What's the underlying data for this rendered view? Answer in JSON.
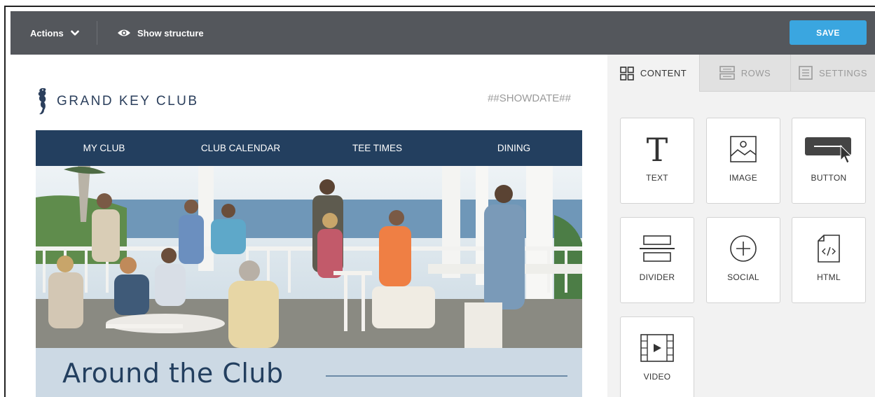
{
  "toolbar": {
    "actions_label": "Actions",
    "show_structure_label": "Show structure",
    "save_label": "SAVE"
  },
  "email": {
    "logo_text": "GRAND KEY CLUB",
    "showdate": "##SHOWDATE##",
    "nav": [
      "MY CLUB",
      "CLUB CALENDAR",
      "TEE TIMES",
      "DINING"
    ],
    "section_title": "Around the Club"
  },
  "panel": {
    "tabs": {
      "content": "CONTENT",
      "rows": "ROWS",
      "settings": "SETTINGS"
    },
    "blocks": [
      "TEXT",
      "IMAGE",
      "BUTTON",
      "DIVIDER",
      "SOCIAL",
      "HTML",
      "VIDEO"
    ]
  },
  "colors": {
    "toolbar_bg": "#54575c",
    "save_button": "#3aa6e0",
    "nav_bg": "#233f5f",
    "band_bg": "#ccd9e4",
    "panel_bg": "#f2f2f2"
  },
  "icons": {
    "actions": "chevron-down-icon",
    "structure": "eye-icon",
    "content_tab": "grid-icon",
    "rows_tab": "rows-icon",
    "settings_tab": "settings-list-icon"
  }
}
